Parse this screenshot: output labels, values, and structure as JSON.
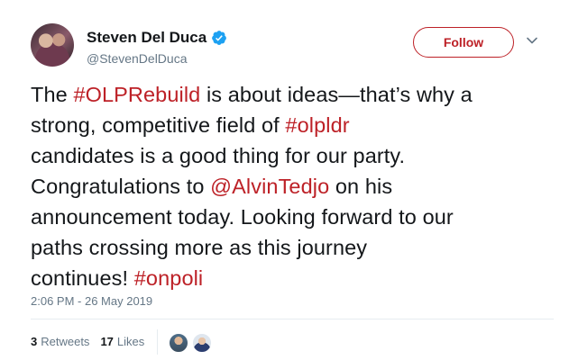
{
  "user": {
    "display_name": "Steven Del Duca",
    "handle": "@StevenDelDuca",
    "verified": true
  },
  "follow_button": {
    "label": "Follow"
  },
  "tweet": {
    "segments": [
      [
        {
          "t": "The ",
          "link": false
        },
        {
          "t": "#OLPRebuild",
          "link": true
        },
        {
          "t": " is about ideas—that’s why a",
          "link": false
        }
      ],
      [
        {
          "t": "strong, competitive field of ",
          "link": false
        },
        {
          "t": "#olpldr",
          "link": true
        }
      ],
      [
        {
          "t": "candidates is a good thing for our party.",
          "link": false
        }
      ],
      [
        {
          "t": "Congratulations to ",
          "link": false
        },
        {
          "t": "@AlvinTedjo",
          "link": true
        },
        {
          "t": " on his",
          "link": false
        }
      ],
      [
        {
          "t": "announcement today. Looking forward to our",
          "link": false
        }
      ],
      [
        {
          "t": "paths crossing more as this journey",
          "link": false
        }
      ],
      [
        {
          "t": "continues! ",
          "link": false
        },
        {
          "t": "#onpoli",
          "link": true
        }
      ]
    ]
  },
  "timestamp": "2:06 PM - 26 May 2019",
  "stats": {
    "retweets_count": "3",
    "retweets_label": "Retweets",
    "likes_count": "17",
    "likes_label": "Likes"
  },
  "colors": {
    "accent": "#bd2127",
    "muted": "#657786",
    "verified": "#1da1f2"
  },
  "icons": [
    "verified-badge-icon",
    "chevron-down-icon"
  ]
}
